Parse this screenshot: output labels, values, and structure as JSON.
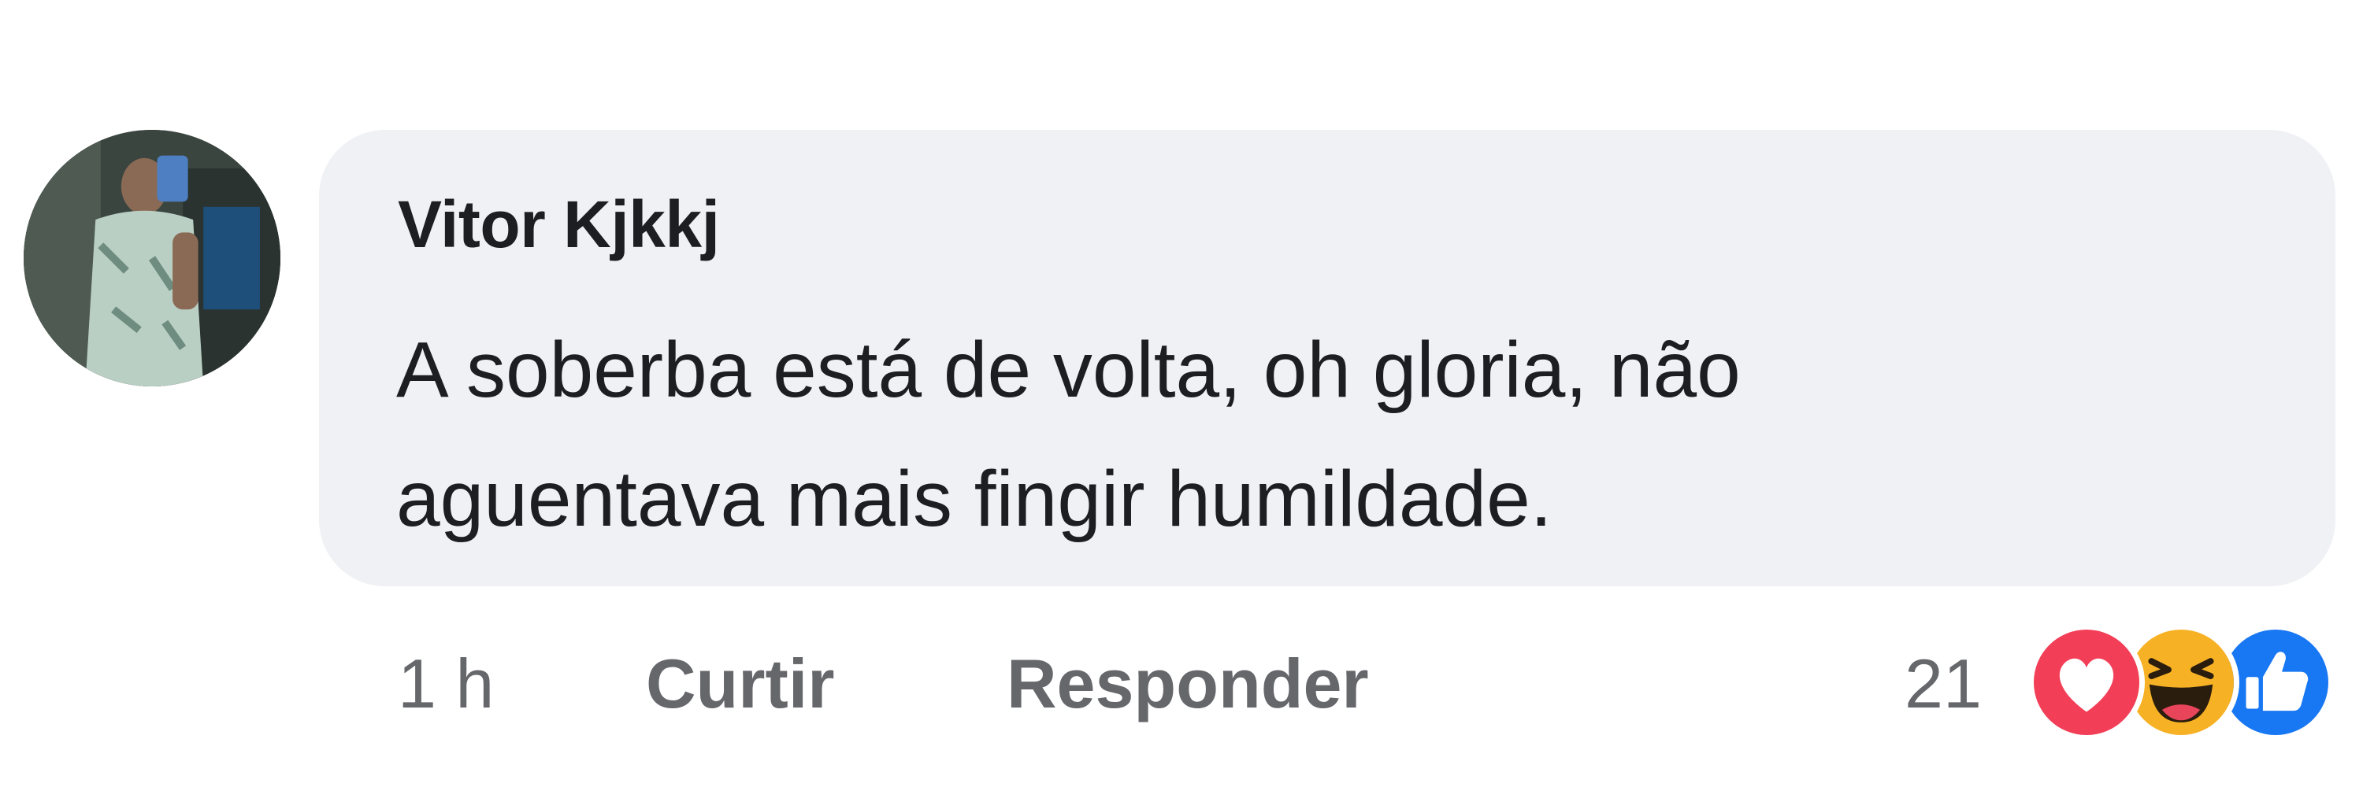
{
  "comment": {
    "author": "Vitor Kjkkj",
    "text_lines": [
      "A soberba está de volta, oh gloria, não",
      "aguentava mais fingir humildade."
    ],
    "time": "1 h",
    "like_label": "Curtir",
    "reply_label": "Responder",
    "reaction_count": "21",
    "reactions": [
      "love-icon",
      "haha-icon",
      "like-icon"
    ]
  },
  "colors": {
    "bubble": "#f0f1f5",
    "text": "#1c1e21",
    "secondary": "#65676b",
    "love": "#f33e58",
    "haha": "#f7b125",
    "like": "#1877f2"
  }
}
